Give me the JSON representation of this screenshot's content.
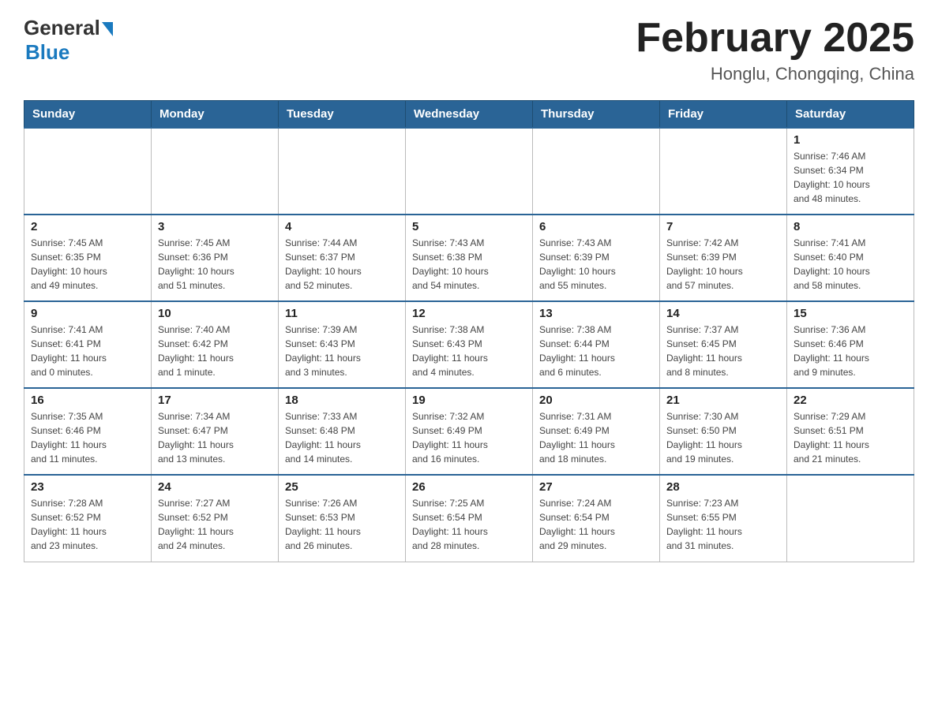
{
  "header": {
    "logo_general": "General",
    "logo_blue": "Blue",
    "month_title": "February 2025",
    "location": "Honglu, Chongqing, China"
  },
  "days_of_week": [
    "Sunday",
    "Monday",
    "Tuesday",
    "Wednesday",
    "Thursday",
    "Friday",
    "Saturday"
  ],
  "weeks": [
    {
      "days": [
        {
          "num": "",
          "info": ""
        },
        {
          "num": "",
          "info": ""
        },
        {
          "num": "",
          "info": ""
        },
        {
          "num": "",
          "info": ""
        },
        {
          "num": "",
          "info": ""
        },
        {
          "num": "",
          "info": ""
        },
        {
          "num": "1",
          "info": "Sunrise: 7:46 AM\nSunset: 6:34 PM\nDaylight: 10 hours\nand 48 minutes."
        }
      ]
    },
    {
      "days": [
        {
          "num": "2",
          "info": "Sunrise: 7:45 AM\nSunset: 6:35 PM\nDaylight: 10 hours\nand 49 minutes."
        },
        {
          "num": "3",
          "info": "Sunrise: 7:45 AM\nSunset: 6:36 PM\nDaylight: 10 hours\nand 51 minutes."
        },
        {
          "num": "4",
          "info": "Sunrise: 7:44 AM\nSunset: 6:37 PM\nDaylight: 10 hours\nand 52 minutes."
        },
        {
          "num": "5",
          "info": "Sunrise: 7:43 AM\nSunset: 6:38 PM\nDaylight: 10 hours\nand 54 minutes."
        },
        {
          "num": "6",
          "info": "Sunrise: 7:43 AM\nSunset: 6:39 PM\nDaylight: 10 hours\nand 55 minutes."
        },
        {
          "num": "7",
          "info": "Sunrise: 7:42 AM\nSunset: 6:39 PM\nDaylight: 10 hours\nand 57 minutes."
        },
        {
          "num": "8",
          "info": "Sunrise: 7:41 AM\nSunset: 6:40 PM\nDaylight: 10 hours\nand 58 minutes."
        }
      ]
    },
    {
      "days": [
        {
          "num": "9",
          "info": "Sunrise: 7:41 AM\nSunset: 6:41 PM\nDaylight: 11 hours\nand 0 minutes."
        },
        {
          "num": "10",
          "info": "Sunrise: 7:40 AM\nSunset: 6:42 PM\nDaylight: 11 hours\nand 1 minute."
        },
        {
          "num": "11",
          "info": "Sunrise: 7:39 AM\nSunset: 6:43 PM\nDaylight: 11 hours\nand 3 minutes."
        },
        {
          "num": "12",
          "info": "Sunrise: 7:38 AM\nSunset: 6:43 PM\nDaylight: 11 hours\nand 4 minutes."
        },
        {
          "num": "13",
          "info": "Sunrise: 7:38 AM\nSunset: 6:44 PM\nDaylight: 11 hours\nand 6 minutes."
        },
        {
          "num": "14",
          "info": "Sunrise: 7:37 AM\nSunset: 6:45 PM\nDaylight: 11 hours\nand 8 minutes."
        },
        {
          "num": "15",
          "info": "Sunrise: 7:36 AM\nSunset: 6:46 PM\nDaylight: 11 hours\nand 9 minutes."
        }
      ]
    },
    {
      "days": [
        {
          "num": "16",
          "info": "Sunrise: 7:35 AM\nSunset: 6:46 PM\nDaylight: 11 hours\nand 11 minutes."
        },
        {
          "num": "17",
          "info": "Sunrise: 7:34 AM\nSunset: 6:47 PM\nDaylight: 11 hours\nand 13 minutes."
        },
        {
          "num": "18",
          "info": "Sunrise: 7:33 AM\nSunset: 6:48 PM\nDaylight: 11 hours\nand 14 minutes."
        },
        {
          "num": "19",
          "info": "Sunrise: 7:32 AM\nSunset: 6:49 PM\nDaylight: 11 hours\nand 16 minutes."
        },
        {
          "num": "20",
          "info": "Sunrise: 7:31 AM\nSunset: 6:49 PM\nDaylight: 11 hours\nand 18 minutes."
        },
        {
          "num": "21",
          "info": "Sunrise: 7:30 AM\nSunset: 6:50 PM\nDaylight: 11 hours\nand 19 minutes."
        },
        {
          "num": "22",
          "info": "Sunrise: 7:29 AM\nSunset: 6:51 PM\nDaylight: 11 hours\nand 21 minutes."
        }
      ]
    },
    {
      "days": [
        {
          "num": "23",
          "info": "Sunrise: 7:28 AM\nSunset: 6:52 PM\nDaylight: 11 hours\nand 23 minutes."
        },
        {
          "num": "24",
          "info": "Sunrise: 7:27 AM\nSunset: 6:52 PM\nDaylight: 11 hours\nand 24 minutes."
        },
        {
          "num": "25",
          "info": "Sunrise: 7:26 AM\nSunset: 6:53 PM\nDaylight: 11 hours\nand 26 minutes."
        },
        {
          "num": "26",
          "info": "Sunrise: 7:25 AM\nSunset: 6:54 PM\nDaylight: 11 hours\nand 28 minutes."
        },
        {
          "num": "27",
          "info": "Sunrise: 7:24 AM\nSunset: 6:54 PM\nDaylight: 11 hours\nand 29 minutes."
        },
        {
          "num": "28",
          "info": "Sunrise: 7:23 AM\nSunset: 6:55 PM\nDaylight: 11 hours\nand 31 minutes."
        },
        {
          "num": "",
          "info": ""
        }
      ]
    }
  ]
}
